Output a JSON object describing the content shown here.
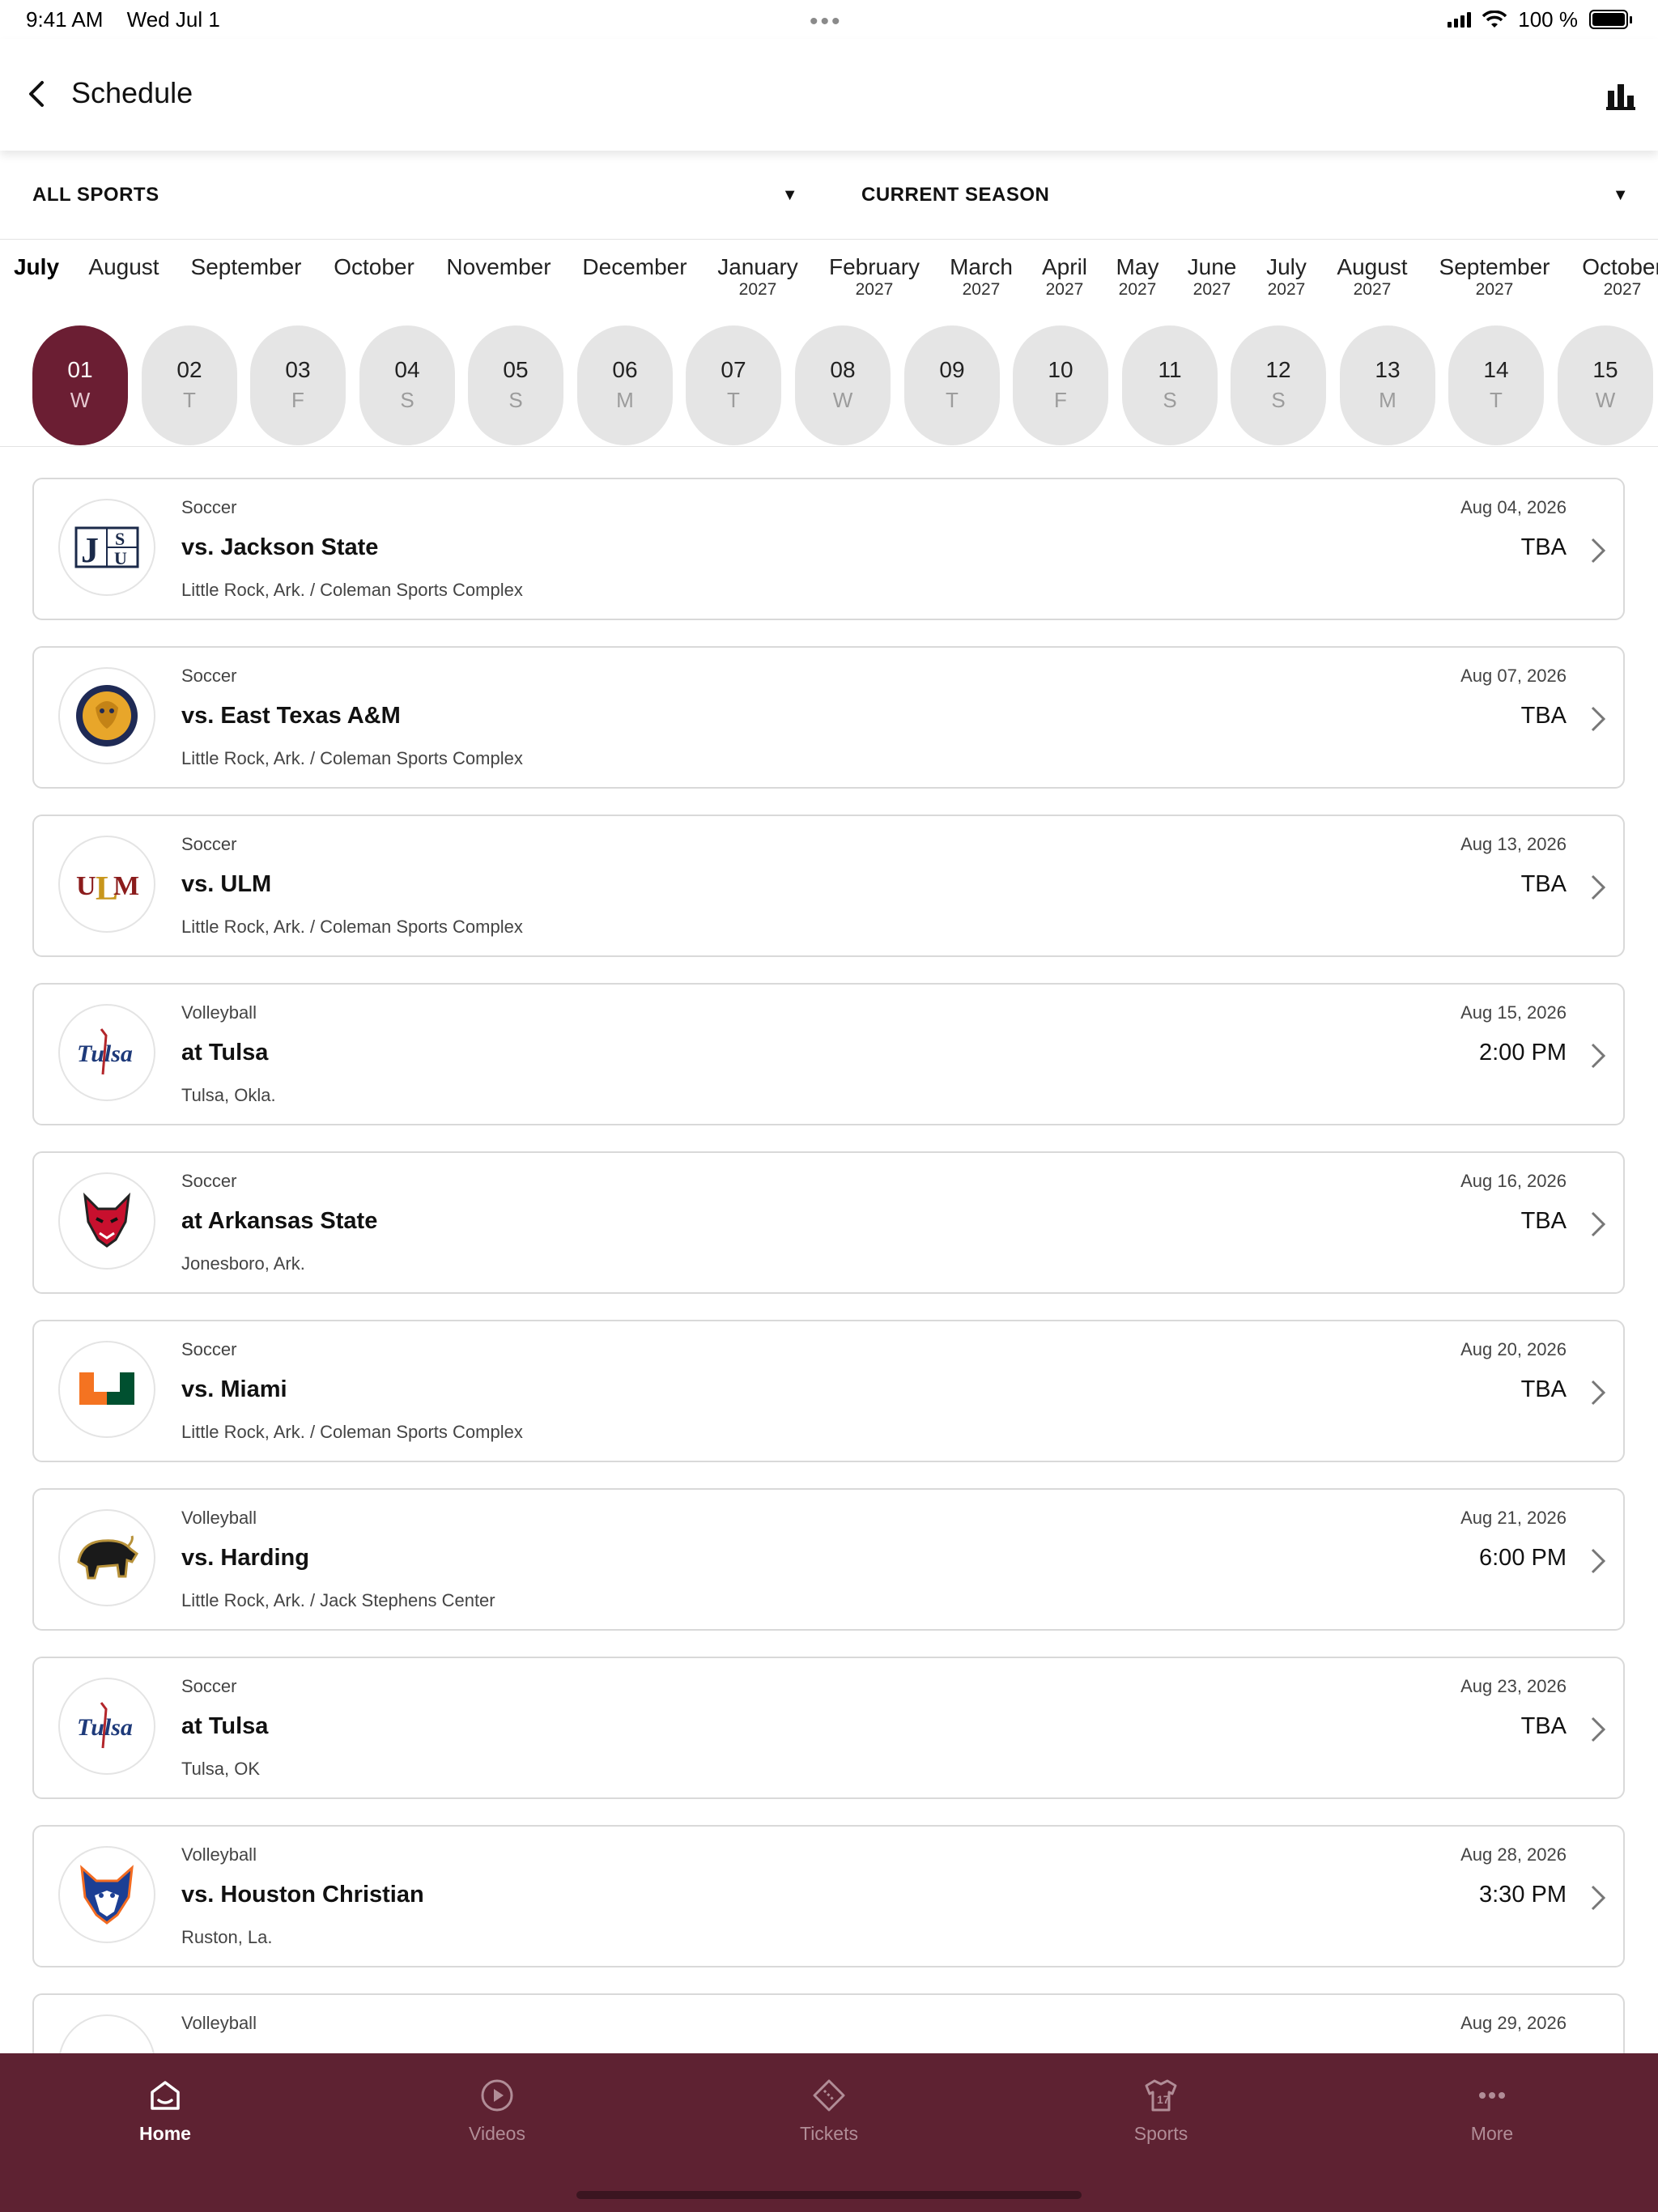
{
  "status_bar": {
    "time": "9:41 AM",
    "date": "Wed Jul 1",
    "battery": "100 %"
  },
  "header": {
    "title": "Schedule"
  },
  "filters": {
    "sport": "ALL SPORTS",
    "season": "CURRENT SEASON",
    "caret": "▼"
  },
  "months": [
    {
      "m": "July",
      "y": ""
    },
    {
      "m": "August",
      "y": ""
    },
    {
      "m": "September",
      "y": ""
    },
    {
      "m": "October",
      "y": ""
    },
    {
      "m": "November",
      "y": ""
    },
    {
      "m": "December",
      "y": ""
    },
    {
      "m": "January",
      "y": "2027"
    },
    {
      "m": "February",
      "y": "2027"
    },
    {
      "m": "March",
      "y": "2027"
    },
    {
      "m": "April",
      "y": "2027"
    },
    {
      "m": "May",
      "y": "2027"
    },
    {
      "m": "June",
      "y": "2027"
    },
    {
      "m": "July",
      "y": "2027"
    },
    {
      "m": "August",
      "y": "2027"
    },
    {
      "m": "September",
      "y": "2027"
    },
    {
      "m": "October",
      "y": "2027"
    }
  ],
  "days": [
    {
      "num": "01",
      "dow": "W"
    },
    {
      "num": "02",
      "dow": "T"
    },
    {
      "num": "03",
      "dow": "F"
    },
    {
      "num": "04",
      "dow": "S"
    },
    {
      "num": "05",
      "dow": "S"
    },
    {
      "num": "06",
      "dow": "M"
    },
    {
      "num": "07",
      "dow": "T"
    },
    {
      "num": "08",
      "dow": "W"
    },
    {
      "num": "09",
      "dow": "T"
    },
    {
      "num": "10",
      "dow": "F"
    },
    {
      "num": "11",
      "dow": "S"
    },
    {
      "num": "12",
      "dow": "S"
    },
    {
      "num": "13",
      "dow": "M"
    },
    {
      "num": "14",
      "dow": "T"
    },
    {
      "num": "15",
      "dow": "W"
    }
  ],
  "events": [
    {
      "sport": "Soccer",
      "opponent": "vs. Jackson State",
      "venue": "Little Rock, Ark. / Coleman Sports Complex",
      "date": "Aug 04, 2026",
      "time": "TBA",
      "logo": "jsu"
    },
    {
      "sport": "Soccer",
      "opponent": "vs. East Texas A&M",
      "venue": "Little Rock, Ark. / Coleman Sports Complex",
      "date": "Aug 07, 2026",
      "time": "TBA",
      "logo": "lion"
    },
    {
      "sport": "Soccer",
      "opponent": "vs. ULM",
      "venue": "Little Rock, Ark. / Coleman Sports Complex",
      "date": "Aug 13, 2026",
      "time": "TBA",
      "logo": "ulm"
    },
    {
      "sport": "Volleyball",
      "opponent": "at Tulsa",
      "venue": "Tulsa, Okla.",
      "date": "Aug 15, 2026",
      "time": "2:00 PM",
      "logo": "tulsa"
    },
    {
      "sport": "Soccer",
      "opponent": "at Arkansas State",
      "venue": "Jonesboro, Ark.",
      "date": "Aug 16, 2026",
      "time": "TBA",
      "logo": "redwolf"
    },
    {
      "sport": "Soccer",
      "opponent": "vs. Miami",
      "venue": "Little Rock, Ark. / Coleman Sports Complex",
      "date": "Aug 20, 2026",
      "time": "TBA",
      "logo": "miami"
    },
    {
      "sport": "Volleyball",
      "opponent": "vs. Harding",
      "venue": "Little Rock, Ark. / Jack Stephens Center",
      "date": "Aug 21, 2026",
      "time": "6:00 PM",
      "logo": "bison"
    },
    {
      "sport": "Soccer",
      "opponent": "at Tulsa",
      "venue": "Tulsa, OK",
      "date": "Aug 23, 2026",
      "time": "TBA",
      "logo": "tulsa"
    },
    {
      "sport": "Volleyball",
      "opponent": "vs. Houston Christian",
      "venue": "Ruston, La.",
      "date": "Aug 28, 2026",
      "time": "3:30 PM",
      "logo": "husky"
    },
    {
      "sport": "Volleyball",
      "opponent": "",
      "venue": "",
      "date": "Aug 29, 2026",
      "time": "",
      "logo": "partial"
    }
  ],
  "tabs": [
    {
      "label": "Home",
      "icon": "home-icon"
    },
    {
      "label": "Videos",
      "icon": "play-icon"
    },
    {
      "label": "Tickets",
      "icon": "ticket-icon"
    },
    {
      "label": "Sports",
      "icon": "jersey-icon"
    },
    {
      "label": "More",
      "icon": "more-icon"
    }
  ],
  "colors": {
    "brand": "#6b1e33",
    "tabbar": "#5e2232"
  }
}
